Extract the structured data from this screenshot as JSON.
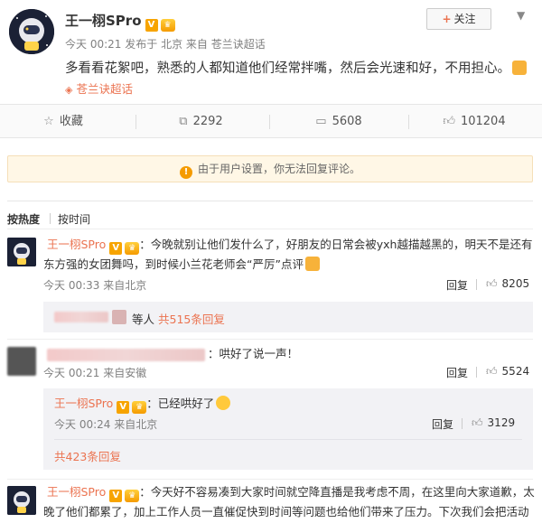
{
  "post": {
    "author": "王一栩SPro",
    "vbadge": "V",
    "time": "今天 00:21",
    "published_from_prefix": "发布于",
    "location": "北京",
    "source_prefix": "来自",
    "source": "苍兰诀超话",
    "follow_label": "关注",
    "text": "多看看花絮吧，熟悉的人都知道他们经常拌嘴，然后会光速和好，不用担心。",
    "topic_tag": "苍兰诀超话"
  },
  "actions": {
    "favorite": "收藏",
    "repost": "2292",
    "comment": "5608",
    "like": "101204"
  },
  "notice": "由于用户设置，你无法回复评论。",
  "sort_tabs": {
    "hot": "按热度",
    "time": "按时间"
  },
  "comments": [
    {
      "author": "王一栩SPro",
      "text_line1": "：今晚就别让他们发什么了，好朋友的日常会被yxh越描越黑的，明天不是还有",
      "text_line2": "东方强的女团舞吗，到时候小兰花老师会“严厉”点评",
      "time": "今天 00:33",
      "source": "来自北京",
      "reply_label": "回复",
      "likes": "8205",
      "replies_summary_mid": "等人",
      "replies_summary_link": "共515条回复"
    },
    {
      "text": "：哄好了说一声！",
      "time": "今天 00:21",
      "source": "来自安徽",
      "reply_label": "回复",
      "likes": "5524",
      "reply": {
        "author": "王一栩SPro",
        "text": "：已经哄好了",
        "time": "今天 00:24",
        "source": "来自北京",
        "reply_label": "回复",
        "likes": "3129"
      },
      "replies_link": "共423条回复"
    },
    {
      "author": "王一栩SPro",
      "text_line1": "：今天好不容易凑到大家时间就空降直播是我考虑不周，在这里向大家道歉，太",
      "text_line2": "晚了他们都累了，加上工作人员一直催促快到时间等问题也给他们带来了压力。下次我们会把活动"
    }
  ],
  "colors": {
    "accent": "#eb7350",
    "vbadge": "#f7a400",
    "notice_bg": "#fff7e6"
  }
}
